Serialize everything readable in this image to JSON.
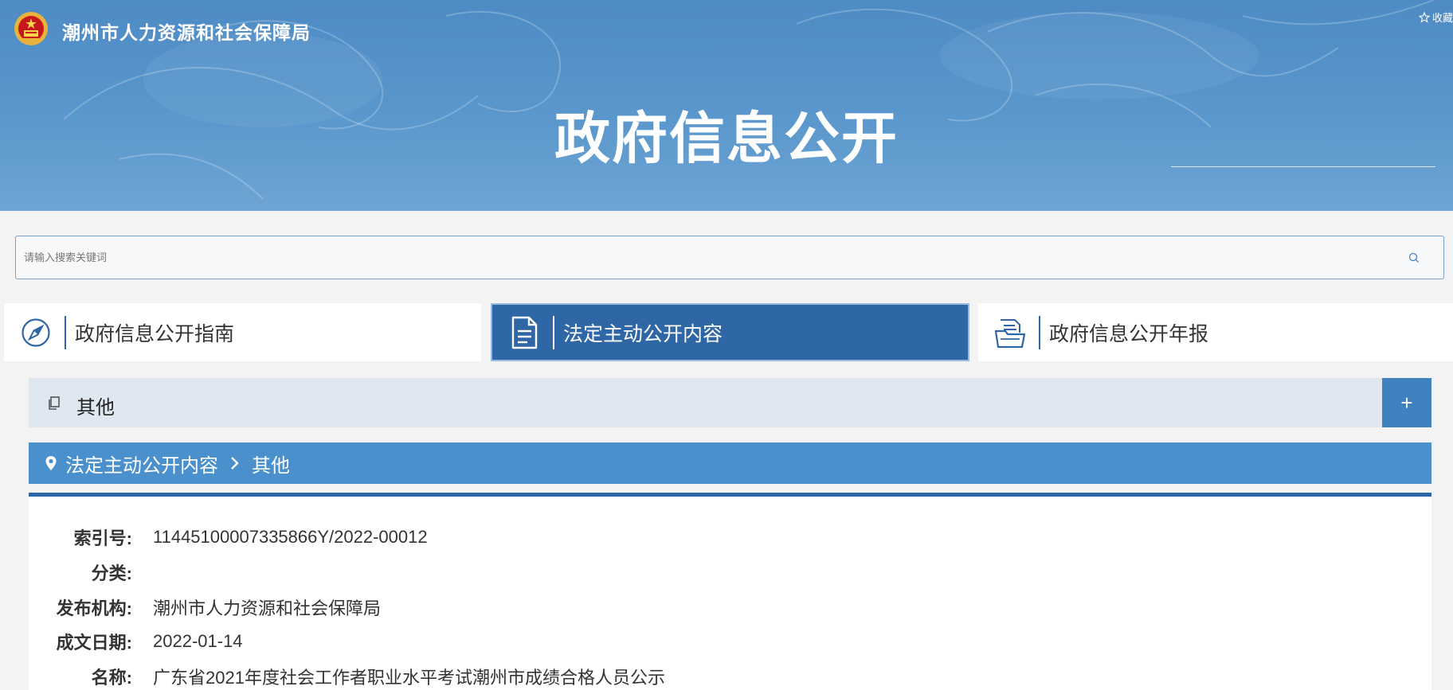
{
  "header": {
    "site_name": "潮州市人力资源和社会保障局",
    "favorite_label": "收藏",
    "banner_title": "政府信息公开"
  },
  "search": {
    "placeholder": "请输入搜索关键词"
  },
  "tabs": [
    {
      "label": "政府信息公开指南",
      "icon": "compass-icon",
      "active": false
    },
    {
      "label": "法定主动公开内容",
      "icon": "document-icon",
      "active": true
    },
    {
      "label": "政府信息公开年报",
      "icon": "folder-icon",
      "active": false
    }
  ],
  "category": {
    "label": "其他",
    "toggle_label": "+"
  },
  "breadcrumb": {
    "items": [
      "法定主动公开内容",
      "其他"
    ]
  },
  "detail": {
    "rows": [
      {
        "label": "索引号:",
        "value": "11445100007335866Y/2022-00012"
      },
      {
        "label": "分类:",
        "value": ""
      },
      {
        "label": "发布机构:",
        "value": "潮州市人力资源和社会保障局"
      },
      {
        "label": "成文日期:",
        "value": "2022-01-14"
      },
      {
        "label": "名称:",
        "value": "广东省2021年度社会工作者职业水平考试潮州市成绩合格人员公示"
      }
    ]
  },
  "colors": {
    "banner": "#5a97cc",
    "accent": "#2f66a5",
    "breadcrumb_bg": "#4a90cc",
    "category_bg": "#dfe8f1"
  }
}
